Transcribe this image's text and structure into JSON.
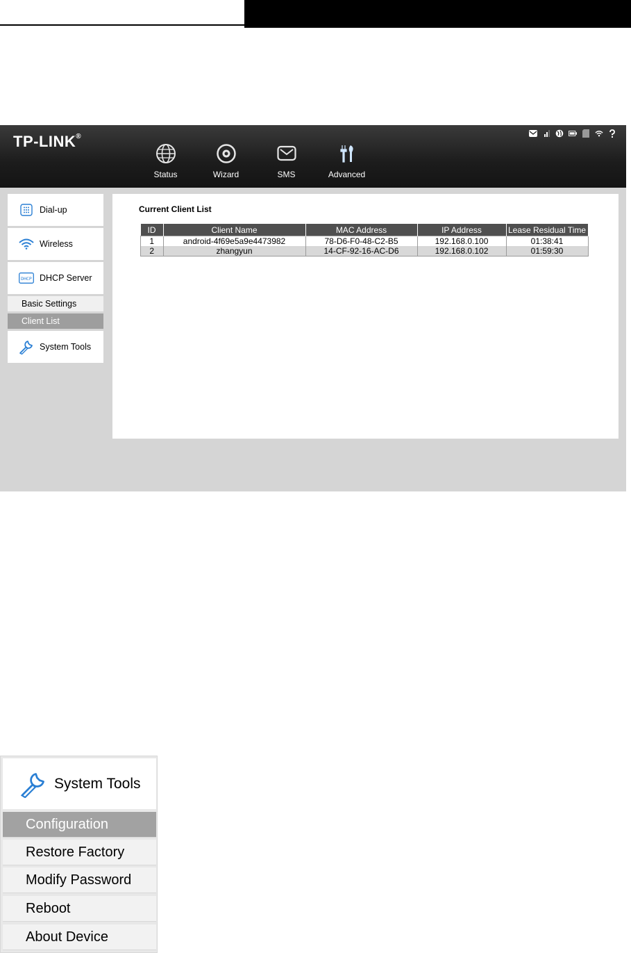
{
  "brand": {
    "logo_text": "TP-LINK",
    "logo_mark": "®"
  },
  "status_icons": [
    "mail-icon",
    "signal-icon",
    "globe-icon",
    "battery-icon",
    "sd-card-icon",
    "wifi-icon",
    "help-icon"
  ],
  "nav": [
    {
      "label": "Status",
      "icon": "globe-icon"
    },
    {
      "label": "Wizard",
      "icon": "wizard-icon"
    },
    {
      "label": "SMS",
      "icon": "envelope-icon"
    },
    {
      "label": "Advanced",
      "icon": "tools-icon"
    }
  ],
  "sidebar": {
    "dialup": "Dial-up",
    "wireless": "Wireless",
    "dhcp": "DHCP Server",
    "dhcp_badge": "DHCP",
    "basic_settings": "Basic Settings",
    "client_list": "Client List",
    "system_tools": "System Tools"
  },
  "content": {
    "title": "Current Client List",
    "columns": [
      "ID",
      "Client Name",
      "MAC Address",
      "IP Address",
      "Lease Residual Time"
    ],
    "rows": [
      [
        "1",
        "android-4f69e5a9e4473982",
        "78-D6-F0-48-C2-B5",
        "192.168.0.100",
        "01:38:41"
      ],
      [
        "2",
        "zhangyun",
        "14-CF-92-16-AC-D6",
        "192.168.0.102",
        "01:59:30"
      ]
    ]
  },
  "system_tools_menu": {
    "title": "System Tools",
    "items": [
      "Configuration",
      "Restore Factory",
      "Modify Password",
      "Reboot",
      "About Device"
    ],
    "active": "Configuration"
  },
  "colors": {
    "header_bg": "#1c1c1c",
    "accent_blue": "#2a7fd4",
    "active_item": "#9e9e9e"
  }
}
